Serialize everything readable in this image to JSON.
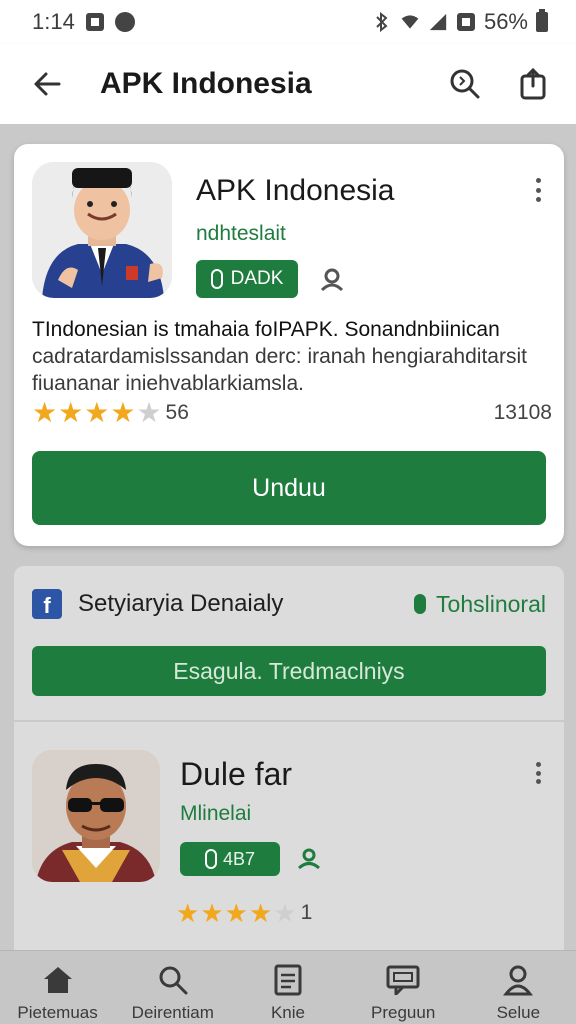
{
  "status_bar": {
    "time": "1:14",
    "battery": "56%"
  },
  "app_bar": {
    "title": "APK Indonesia",
    "icons": [
      "back-arrow-icon",
      "search-icon",
      "share-icon"
    ]
  },
  "featured_app": {
    "name": "APK Indonesia",
    "developer": "ndhteslait",
    "badge_label": "DADK",
    "description_lines": [
      "TIndonesian is tmahaia foIPAPK. Sonandnbiinican",
      "cadratardamislssandan derc: iranah hengiarahditarsit",
      "fiuananar iniehvablarkiamsla."
    ],
    "rating_stars": 4.5,
    "rating_count": "56",
    "downloads": "13108",
    "install_label": "Unduu"
  },
  "secondary_section": {
    "source_label": "Setyiaryia Denaialy",
    "source_right_label": "Tohslinoral",
    "action_label": "Esagula. Tredmaclniys",
    "app": {
      "name": "Dule far",
      "developer": "Mlinelai",
      "badge_label": "4B7",
      "rating_stars": 4,
      "rating_count": "1"
    }
  },
  "bottom_nav": [
    {
      "label": "Pietemuas",
      "icon": "home-icon"
    },
    {
      "label": "Deirentiam",
      "icon": "search-icon"
    },
    {
      "label": "Knie",
      "icon": "document-icon"
    },
    {
      "label": "Preguun",
      "icon": "chat-icon"
    },
    {
      "label": "Selue",
      "icon": "profile-icon"
    }
  ],
  "colors": {
    "accent_green": "#1e7d3e",
    "star": "#f2a81d",
    "background_dim": "#c9c9c9"
  }
}
